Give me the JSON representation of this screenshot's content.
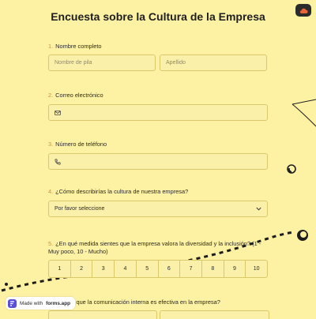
{
  "title": "Encuesta sobre la Cultura de la Empresa",
  "top_button_icon": "cloud-save-icon",
  "questions": [
    {
      "num": "1.",
      "label": "Nombre completo",
      "first_placeholder": "Nombre de pila",
      "last_placeholder": "Apellido"
    },
    {
      "num": "2.",
      "label": "Correo electrónico",
      "icon": "mail-icon"
    },
    {
      "num": "3.",
      "label": "Número de teléfono",
      "icon": "phone-icon"
    },
    {
      "num": "4.",
      "label": "¿Cómo describirías la cultura de nuestra empresa?",
      "select_value": "Por favor seleccione"
    },
    {
      "num": "5.",
      "label": "¿En qué medida sientes que la empresa valora la diversidad y la inclusión? (1 - Muy poco, 10 - Mucho)",
      "scale": [
        "1",
        "2",
        "3",
        "4",
        "5",
        "6",
        "7",
        "8",
        "9",
        "10"
      ]
    },
    {
      "num": "6.",
      "label": "¿Crees que la comunicación interna es efectiva en la empresa?"
    }
  ],
  "badge": {
    "prefix": "Made with",
    "brand": "forms.app"
  },
  "colors": {
    "background": "#fdf1a4",
    "field": "#fbf0aa",
    "border": "#d9c86a",
    "number": "#c8953b"
  }
}
